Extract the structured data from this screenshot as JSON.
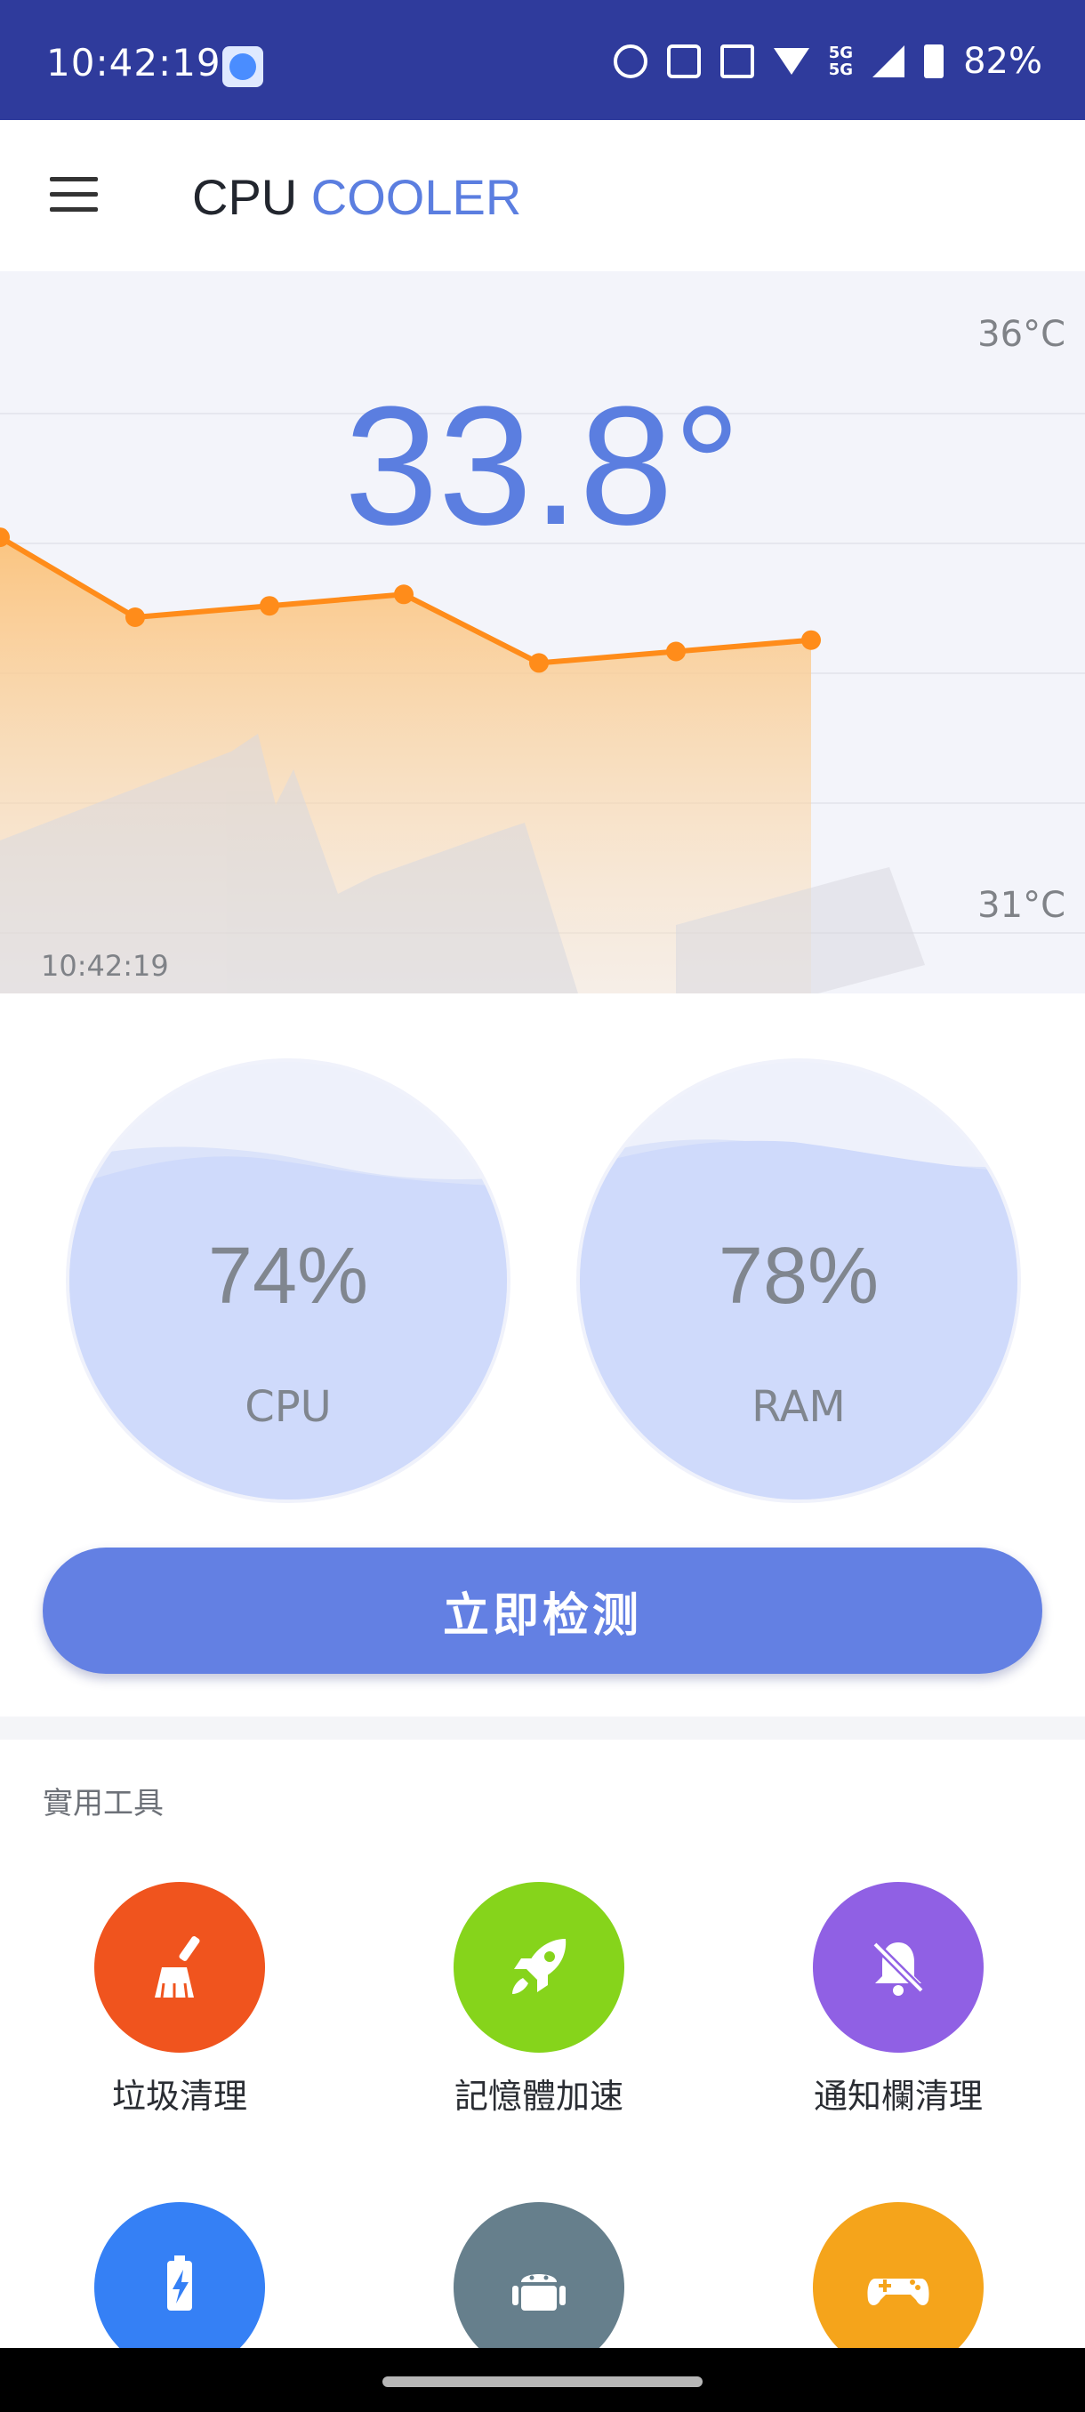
{
  "status_bar": {
    "time": "10:42:19",
    "battery": "82%",
    "icons": [
      "app-notification-icon",
      "alarm-icon",
      "nfc-icon",
      "grid-icon",
      "wifi-icon",
      "5g-icon",
      "signal-icon",
      "battery-icon"
    ],
    "network": "5G"
  },
  "app": {
    "title_part1": "CPU",
    "title_part2": "COOLER",
    "menu_icon": "hamburger-menu-icon"
  },
  "temperature": {
    "current": "33.8°",
    "max_label": "36°C",
    "min_label": "31°C",
    "time_label": "10:42:19"
  },
  "chart_data": {
    "type": "area",
    "y_axis_range": [
      31,
      36
    ],
    "values": [
      34.2,
      33.5,
      33.6,
      33.7,
      33.1,
      33.2,
      33.3
    ],
    "ymax_label": "36°C",
    "ymin_label": "31°C",
    "line_color": "#ff8c1a",
    "grid": true
  },
  "gauges": {
    "cpu": {
      "value": "74%",
      "label": "CPU",
      "fill_fraction": 0.74
    },
    "ram": {
      "value": "78%",
      "label": "RAM",
      "fill_fraction": 0.78
    }
  },
  "detect_button": {
    "label": "立即检测"
  },
  "tools": {
    "section_title": "實用工具",
    "items": [
      {
        "label": "垃圾清理",
        "icon": "broom-icon",
        "color": "#f0541e"
      },
      {
        "label": "記憶體加速",
        "icon": "rocket-icon",
        "color": "#86d41b"
      },
      {
        "label": "通知欄清理",
        "icon": "bell-off-icon",
        "color": "#9060e4"
      },
      {
        "label": "",
        "icon": "battery-charge-icon",
        "color": "#3580f5"
      },
      {
        "label": "",
        "icon": "android-icon",
        "color": "#667f8c"
      },
      {
        "label": "",
        "icon": "gamepad-icon",
        "color": "#f5a41b"
      }
    ]
  },
  "colors": {
    "status_bar": "#2f3b9c",
    "accent": "#5b7ee0",
    "button": "#6380e3"
  }
}
